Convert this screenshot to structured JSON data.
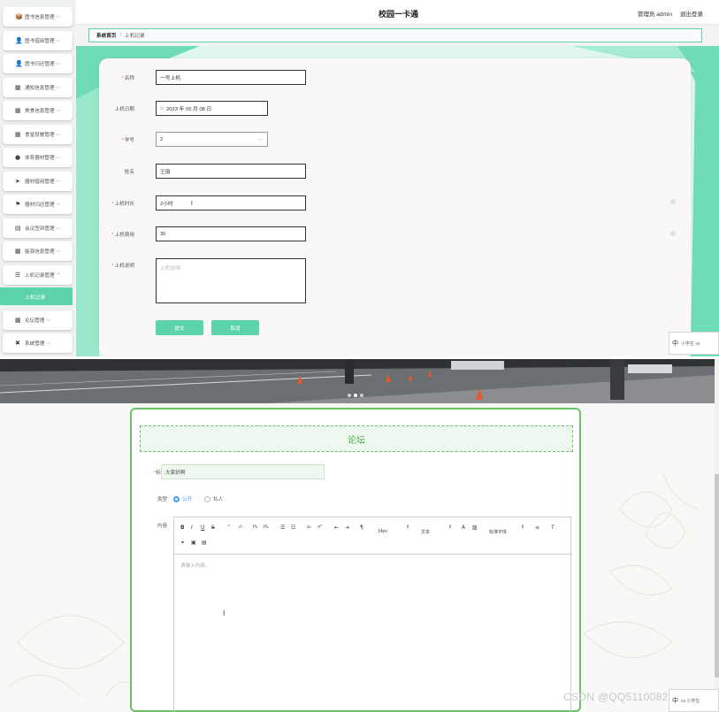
{
  "admin": {
    "app_title": "校园一卡通",
    "user_label": "管理员 admin",
    "logout": "退出登录",
    "sidebar": [
      {
        "label": "图书信息管理",
        "icon": "📦",
        "open": false
      },
      {
        "label": "图书借阅管理",
        "icon": "👤",
        "open": false
      },
      {
        "label": "图书归还管理",
        "icon": "👤",
        "open": false
      },
      {
        "label": "通知信息管理",
        "icon": "▦",
        "open": false
      },
      {
        "label": "美食信息管理",
        "icon": "▦",
        "open": false
      },
      {
        "label": "食堂就餐管理",
        "icon": "▦",
        "open": false
      },
      {
        "label": "体育器材管理",
        "icon": "●",
        "open": false
      },
      {
        "label": "器材借用管理",
        "icon": "➤",
        "open": false
      },
      {
        "label": "器材归还管理",
        "icon": "⚑",
        "open": false
      },
      {
        "label": "会议签到管理",
        "icon": "▤",
        "open": false
      },
      {
        "label": "能源信息管理",
        "icon": "▦",
        "open": false
      },
      {
        "label": "上机记录管理",
        "icon": "☰",
        "open": true
      },
      {
        "label": "论坛管理",
        "icon": "▦",
        "open": false
      },
      {
        "label": "系统管理",
        "icon": "✖",
        "open": false
      }
    ],
    "sidebar_active": "上机记录",
    "breadcrumb": {
      "home": "系统首页",
      "separator": "⁝",
      "current": "上机记录"
    },
    "form": {
      "name": {
        "label": "名称",
        "required": true,
        "value": "一号上机"
      },
      "date": {
        "label": "上机日期",
        "required": false,
        "value": "2023 年 05 月 08 日"
      },
      "student_no": {
        "label": "学号",
        "required": true,
        "value": "2"
      },
      "student_name": {
        "label": "姓名",
        "required": false,
        "value": "王丽"
      },
      "duration": {
        "label": "上机时长",
        "required": true,
        "value": "2小时"
      },
      "fee": {
        "label": "上机费用",
        "required": true,
        "value": "30"
      },
      "note": {
        "label": "上机说明",
        "required": true,
        "placeholder": "上机说明"
      }
    },
    "buttons": {
      "submit": "提交",
      "cancel": "取消"
    },
    "colors": {
      "accent": "#5dd3ad",
      "panel": "#f9f7f7"
    }
  },
  "ime": {
    "lang": "中",
    "hint": "小学生 vs",
    "sub": "vs 小学生"
  },
  "forum": {
    "heading": "论坛",
    "title_label": "标题",
    "title_value": "大家好啊",
    "type_label": "类型",
    "type_public": "公开",
    "type_private": "私人",
    "content_label": "内容",
    "toolbar": {
      "size": "14px",
      "text_type": "文本",
      "font": "标准字体"
    },
    "editor_placeholder": "请输入内容...",
    "colors": {
      "accent": "#6cc068",
      "tint": "#eef8ee"
    }
  },
  "watermark": "CSDN @QQ511008285"
}
